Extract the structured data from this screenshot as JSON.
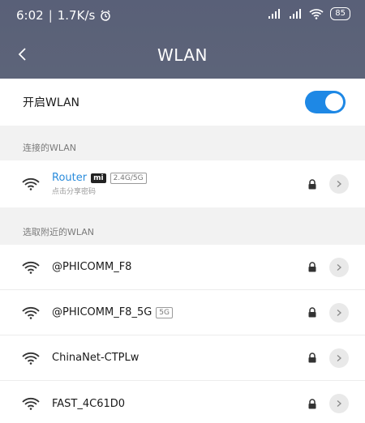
{
  "status_bar": {
    "time": "6:02",
    "separator": "|",
    "speed": "1.7K/s",
    "battery": "85"
  },
  "titlebar": {
    "title": "WLAN"
  },
  "toggle": {
    "label": "开启WLAN",
    "on": true
  },
  "connected": {
    "section_label": "连接的WLAN",
    "network": {
      "name": "Router",
      "brand": "mi",
      "band": "2.4G/5G",
      "subtitle": "点击分享密码"
    }
  },
  "nearby": {
    "section_label": "选取附近的WLAN",
    "networks": [
      {
        "name": "@PHICOMM_F8",
        "tag": ""
      },
      {
        "name": "@PHICOMM_F8_5G",
        "tag": "5G"
      },
      {
        "name": "ChinaNet-CTPLw",
        "tag": ""
      },
      {
        "name": "FAST_4C61D0",
        "tag": ""
      }
    ]
  },
  "colors": {
    "header": "#5d6479",
    "accent": "#1e88e5",
    "connected_text": "#2a8cdc"
  },
  "icons": {
    "back": "chevron-left-icon",
    "wifi": "wifi-icon",
    "lock": "lock-icon",
    "detail": "chevron-right-icon"
  }
}
